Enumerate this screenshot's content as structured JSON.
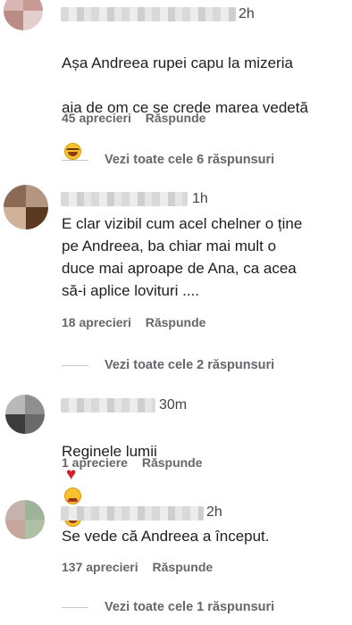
{
  "comments": [
    {
      "time": "2h",
      "text_line1": "Așa Andreea rupei capu la mizeria",
      "text_line2": "aia de om ce se crede marea vedetă",
      "likes": "45 aprecieri",
      "reply": "Răspunde",
      "view_replies": "Vezi toate cele 6 răspunsuri"
    },
    {
      "time": "1h",
      "text": "E clar vizibil cum acel chelner o ține\npe Andreea, ba chiar mai mult o\nduce mai aproape de Ana, ca acea\nsă-i aplice lovituri ....",
      "likes": "18 aprecieri",
      "reply": "Răspunde",
      "view_replies": "Vezi toate cele 2 răspunsuri"
    },
    {
      "time": "30m",
      "text": "Reginele lumii",
      "likes": "1 apreciere",
      "reply": "Răspunde"
    },
    {
      "time": "2h",
      "text": "Se vede că Andreea a început.",
      "likes": "137 aprecieri",
      "reply": "Răspunde",
      "view_replies": "Vezi toate cele 1 răspunsuri"
    }
  ],
  "colors": {
    "meta": "#65676b",
    "heart": "#d61f2b",
    "emoji": "#f7c12e"
  },
  "icons": [
    "laughing-emoji-icon",
    "heart-icon",
    "star-eyes-emoji-icon"
  ]
}
